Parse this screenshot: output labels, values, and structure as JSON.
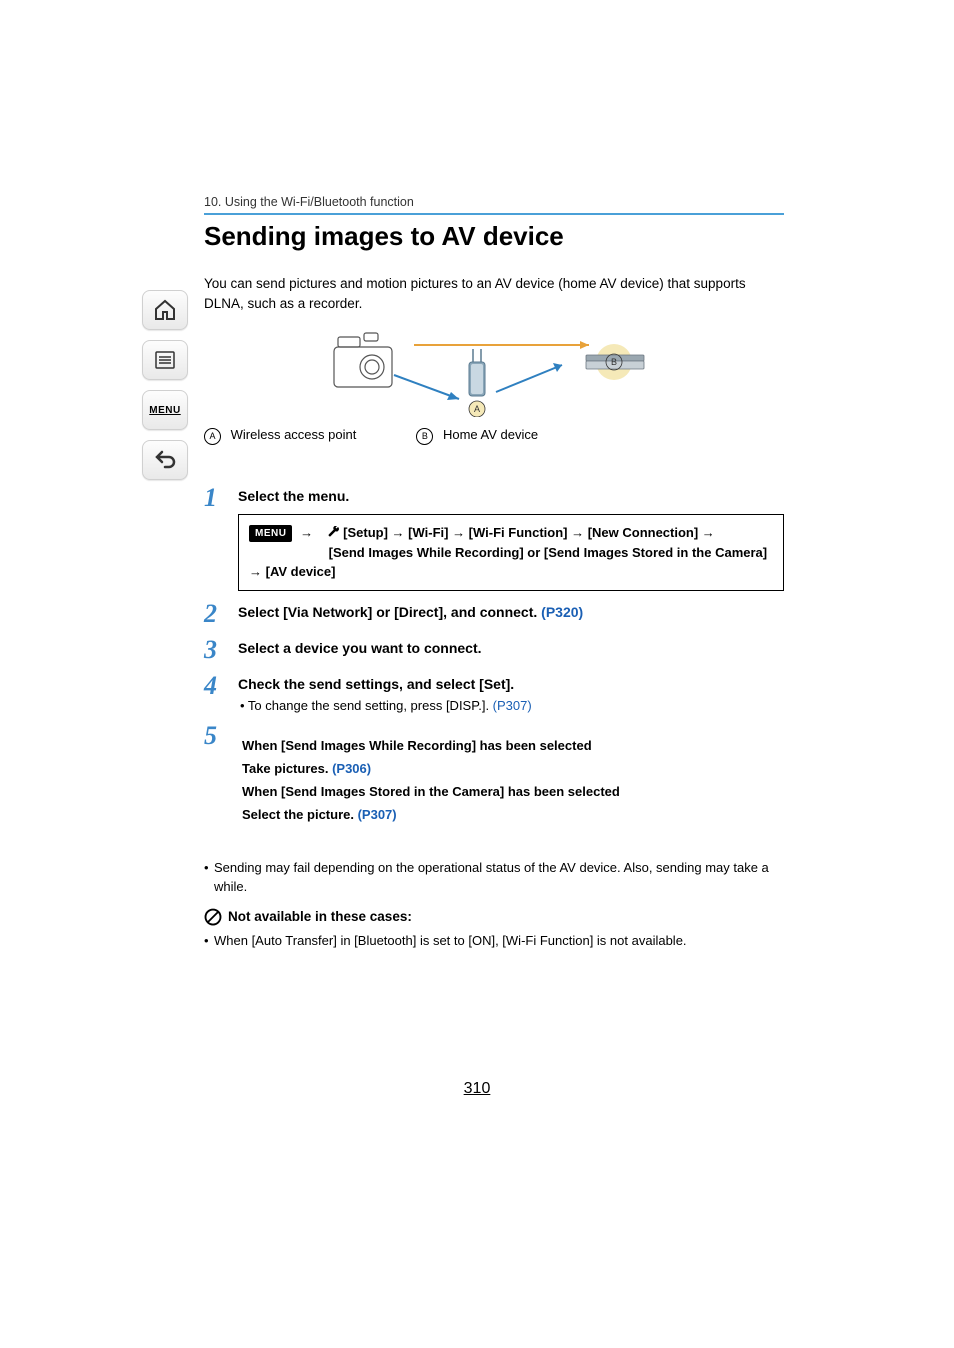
{
  "chapter": "10. Using the Wi-Fi/Bluetooth function",
  "title": "Sending images to AV device",
  "intro": "You can send pictures and motion pictures to an AV device (home AV device) that supports DLNA, such as a recorder.",
  "legend": {
    "a_letter": "A",
    "a_label": "Wireless access point",
    "b_letter": "B",
    "b_label": "Home AV device"
  },
  "sidebar": {
    "menu_label": "MENU"
  },
  "steps": {
    "s1": {
      "num": "1",
      "title": "Select the menu.",
      "menu_pill": "MENU",
      "menu_path_line1": "[Setup] → [Wi-Fi] → [Wi-Fi Function] → [New Connection] →",
      "menu_path_line2": "[Send Images While Recording] or [Send Images Stored in the Camera] → [AV device]"
    },
    "s2": {
      "num": "2",
      "title_pre": "Select [Via Network] or [Direct], and connect. ",
      "title_link": "(P320)"
    },
    "s3": {
      "num": "3",
      "title": "Select a device you want to connect."
    },
    "s4": {
      "num": "4",
      "title": "Check the send settings, and select [Set].",
      "bullet_pre": "• To change the send setting, press [DISP.]. ",
      "bullet_link": "(P307)"
    },
    "s5": {
      "num": "5",
      "cond1": "When [Send Images While Recording] has been selected",
      "act1_pre": "Take pictures. ",
      "act1_link": "(P306)",
      "cond2": "When [Send Images Stored in the Camera] has been selected",
      "act2_pre": "Select the picture. ",
      "act2_link": "(P307)"
    }
  },
  "notes": {
    "n1": "Sending may fail depending on the operational status of the AV device. Also, sending may take a while.",
    "na_title": "Not available in these cases:",
    "n2": "When [Auto Transfer] in [Bluetooth] is set to [ON], [Wi-Fi Function] is not available."
  },
  "page_number": "310"
}
